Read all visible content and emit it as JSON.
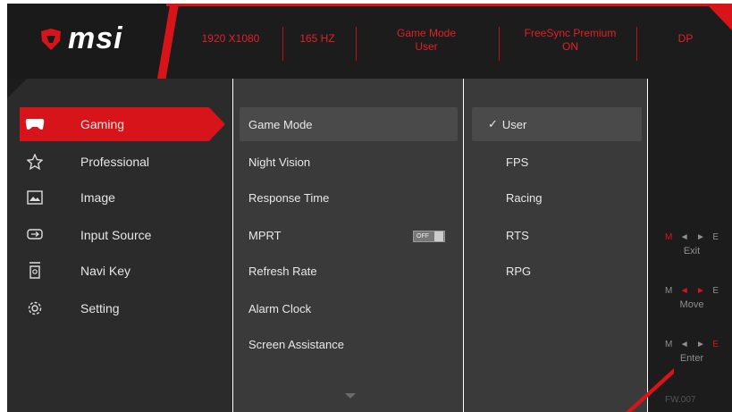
{
  "brand": {
    "name": "msi"
  },
  "header": {
    "resolution": "1920 X1080",
    "refresh": "165 HZ",
    "game_mode_label": "Game Mode",
    "game_mode_value": "User",
    "freesync_label": "FreeSync Premium",
    "freesync_value": "ON",
    "input": "DP"
  },
  "categories": [
    {
      "label": "Gaming",
      "icon": "gamepad-icon",
      "selected": true
    },
    {
      "label": "Professional",
      "icon": "star-icon"
    },
    {
      "label": "Image",
      "icon": "image-icon"
    },
    {
      "label": "Input Source",
      "icon": "input-source-icon"
    },
    {
      "label": "Navi Key",
      "icon": "navi-key-icon"
    },
    {
      "label": "Setting",
      "icon": "gear-icon"
    }
  ],
  "items": [
    {
      "label": "Game Mode",
      "selected": true
    },
    {
      "label": "Night Vision"
    },
    {
      "label": "Response Time"
    },
    {
      "label": "MPRT",
      "toggle": "OFF"
    },
    {
      "label": "Refresh Rate"
    },
    {
      "label": "Alarm Clock"
    },
    {
      "label": "Screen Assistance"
    }
  ],
  "options": [
    {
      "label": "User",
      "selected": true,
      "check": "✓"
    },
    {
      "label": "FPS"
    },
    {
      "label": "Racing"
    },
    {
      "label": "RTS"
    },
    {
      "label": "RPG"
    }
  ],
  "keyhints": [
    {
      "label": "Exit",
      "keys": [
        "M",
        "◄",
        "►",
        "E"
      ]
    },
    {
      "label": "Move",
      "keys": [
        "M",
        "◄",
        "►",
        "E"
      ]
    },
    {
      "label": "Enter",
      "keys": [
        "M",
        "◄",
        "►",
        "E"
      ]
    }
  ],
  "footer": {
    "version": "FW.007"
  },
  "colors": {
    "accent": "#d8141b",
    "panel_dark": "#2b2b2b",
    "panel_mid": "#3a3a3a"
  }
}
